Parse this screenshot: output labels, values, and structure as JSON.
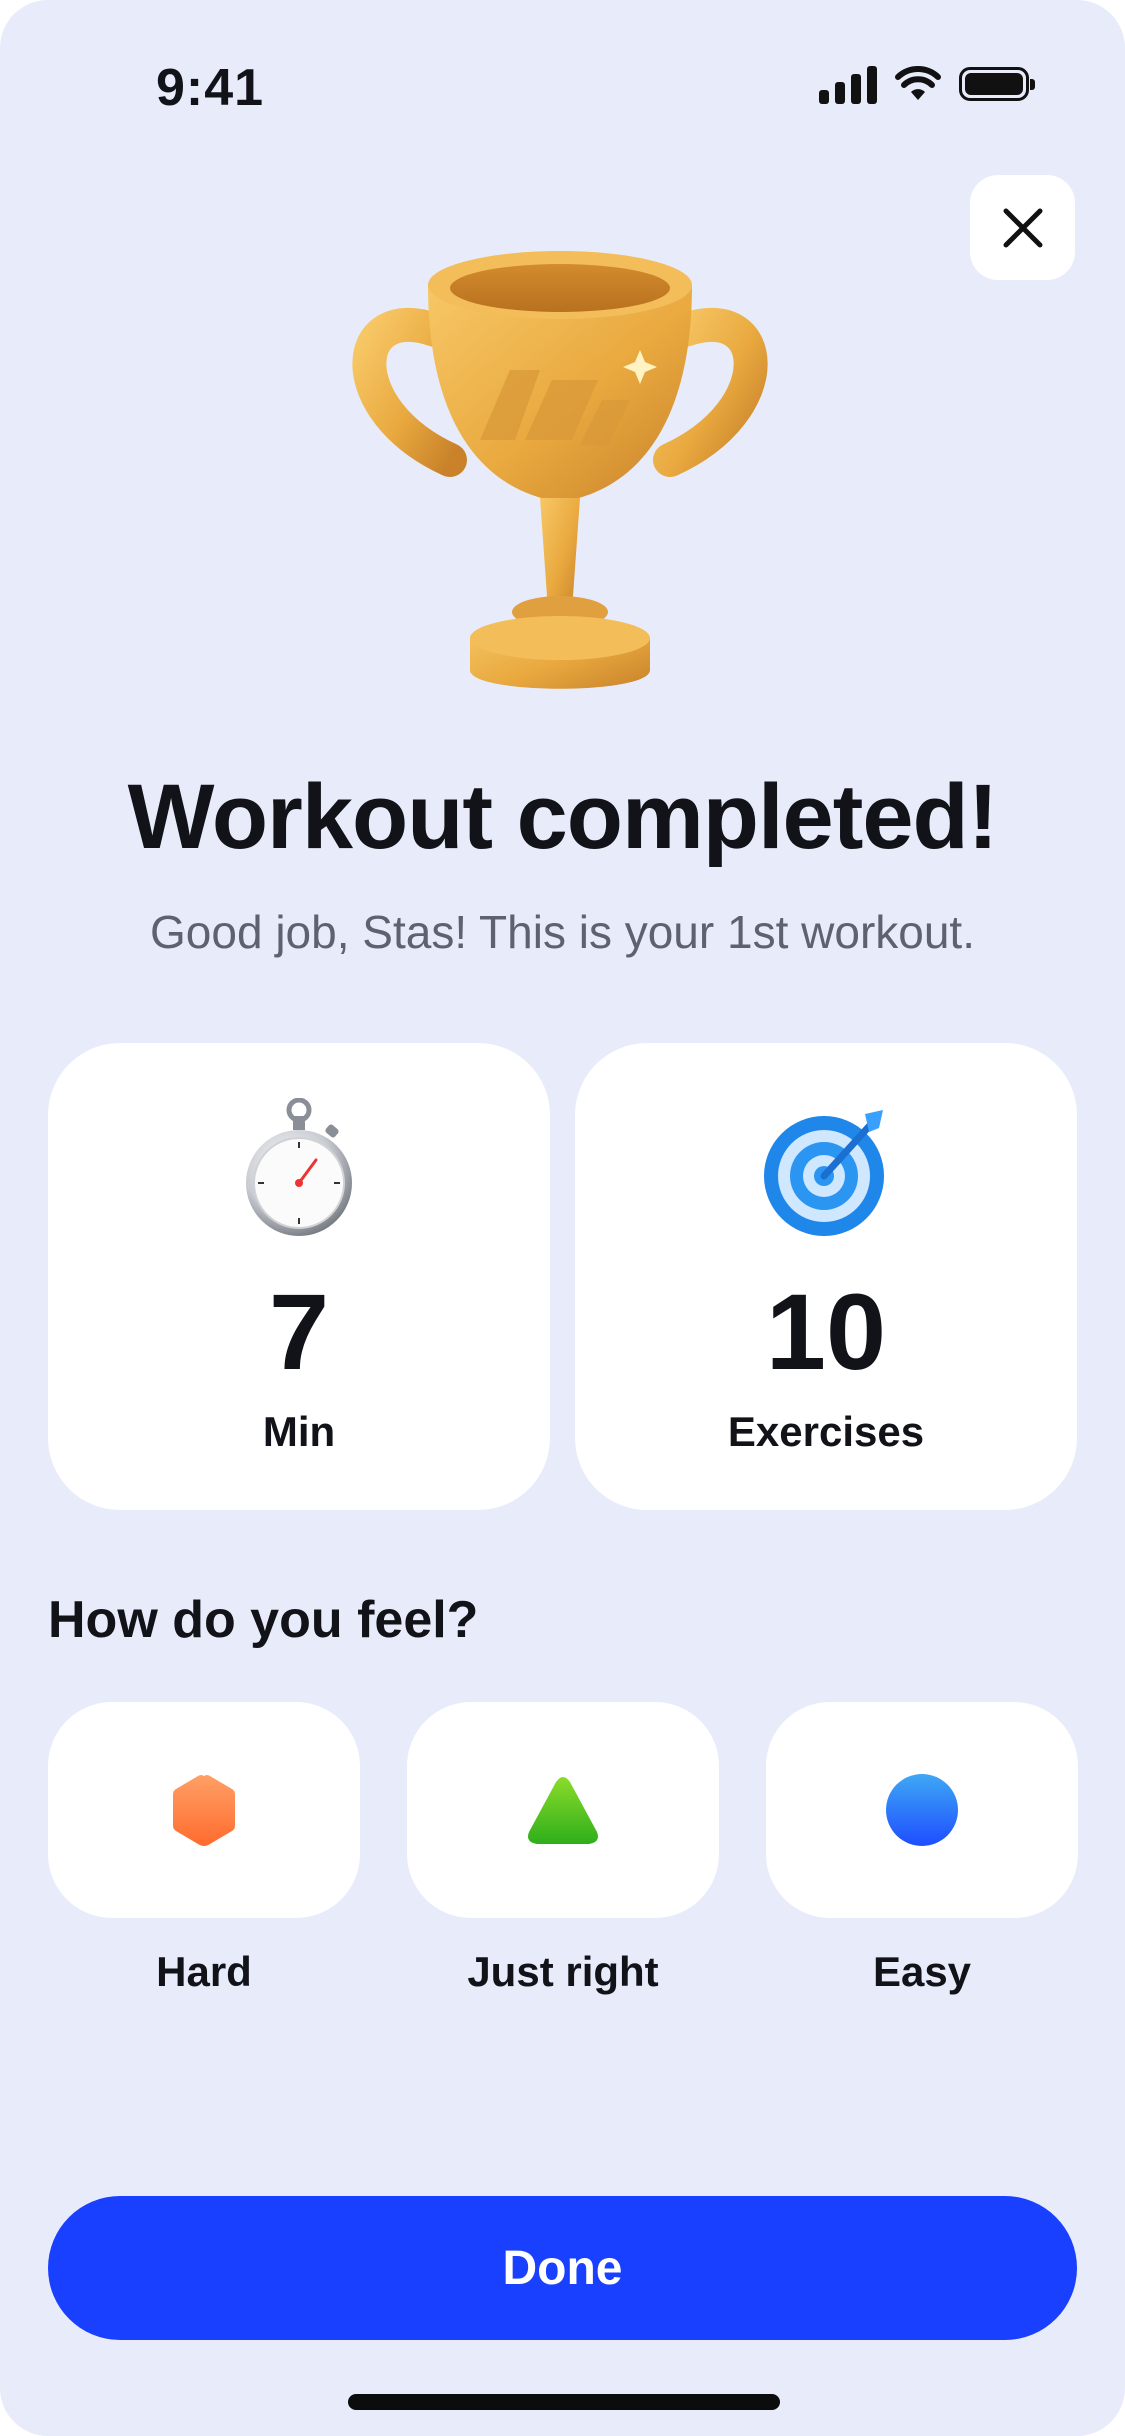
{
  "status_bar": {
    "time": "9:41",
    "icons": [
      "signal-icon",
      "wifi-icon",
      "battery-icon"
    ]
  },
  "close_icon": "close-icon",
  "hero": {
    "icon": "trophy-icon",
    "title": "Workout completed!",
    "subtitle": "Good job, Stas! This is your 1st workout."
  },
  "stats": [
    {
      "icon": "stopwatch-icon",
      "value": "7",
      "label": "Min"
    },
    {
      "icon": "target-icon",
      "value": "10",
      "label": "Exercises"
    }
  ],
  "feel": {
    "heading": "How do you feel?",
    "options": [
      {
        "icon": "hexagon-icon",
        "label": "Hard",
        "color": "#ff7a3d"
      },
      {
        "icon": "triangle-icon",
        "label": "Just right",
        "color": "#3fbf1f"
      },
      {
        "icon": "circle-icon",
        "label": "Easy",
        "color": "#2a6bff"
      }
    ]
  },
  "done_label": "Done",
  "colors": {
    "background": "#e8ecfa",
    "primary": "#1940ff",
    "trophy_gold": "#e9a93f"
  }
}
